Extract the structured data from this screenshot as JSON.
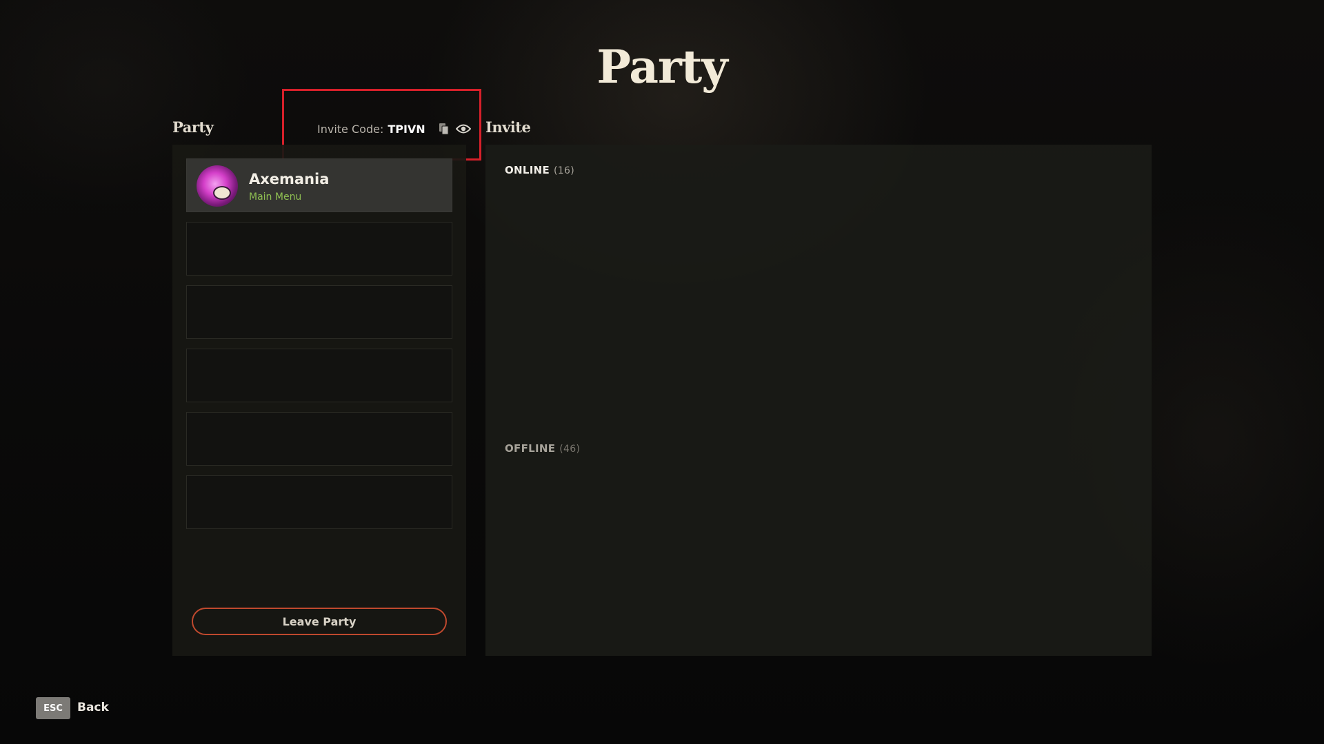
{
  "page": {
    "title": "Party"
  },
  "party": {
    "label": "Party",
    "invite_code_label": "Invite Code:",
    "invite_code": "TPIVN",
    "copy_icon": "copy-icon",
    "visibility_icon": "eye-icon",
    "members": [
      {
        "name": "Axemania",
        "status": "Main Menu",
        "avatar": "pink-flame-avatar"
      }
    ],
    "empty_slots": 5,
    "leave_label": "Leave Party"
  },
  "invite": {
    "label": "Invite",
    "online": {
      "label": "ONLINE",
      "count": "(16)"
    },
    "offline": {
      "label": "OFFLINE",
      "count": "(46)"
    }
  },
  "footer": {
    "esc_key": "ESC",
    "back_label": "Back"
  },
  "colors": {
    "accent_highlight": "#d7202a",
    "status_green": "#8fbf52",
    "leave_border": "#c0492e"
  }
}
